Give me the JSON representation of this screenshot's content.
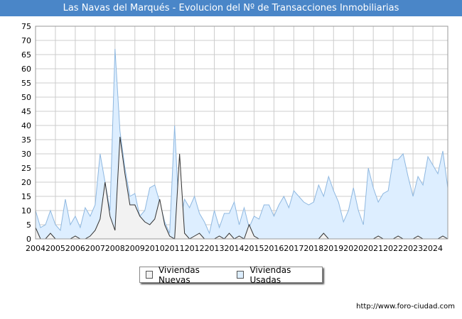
{
  "title": "Las Navas del Marqués - Evolucion del Nº de Transacciones Inmobiliarias",
  "footer": "http://www.foro-ciudad.com",
  "colors": {
    "title_bg": "#4a86c8",
    "nuevas_fill": "#f2f2f2",
    "nuevas_line": "#333333",
    "usadas_fill": "#ddeeff",
    "usadas_line": "#8fb8e0",
    "grid": "#cccccc"
  },
  "chart_data": {
    "type": "area",
    "title": "Las Navas del Marqués - Evolucion del Nº de Transacciones Inmobiliarias",
    "xlabel": "",
    "ylabel": "",
    "x_ticks": [
      "2004",
      "2005",
      "2006",
      "2007",
      "2008",
      "2009",
      "2010",
      "2011",
      "2012",
      "2013",
      "2014",
      "2015",
      "2016",
      "2017",
      "2018",
      "2019",
      "2020",
      "2021",
      "2022",
      "2023",
      "2024"
    ],
    "y_ticks": [
      0,
      5,
      10,
      15,
      20,
      25,
      30,
      35,
      40,
      45,
      50,
      55,
      60,
      65,
      70,
      75
    ],
    "xlim": [
      2004,
      2024.75
    ],
    "ylim": [
      0,
      75
    ],
    "grid": true,
    "legend_position": "bottom-center",
    "x": [
      2004,
      2004.25,
      2004.5,
      2004.75,
      2005,
      2005.25,
      2005.5,
      2005.75,
      2006,
      2006.25,
      2006.5,
      2006.75,
      2007,
      2007.25,
      2007.5,
      2007.75,
      2008,
      2008.25,
      2008.5,
      2008.75,
      2009,
      2009.25,
      2009.5,
      2009.75,
      2010,
      2010.25,
      2010.5,
      2010.75,
      2011,
      2011.25,
      2011.5,
      2011.75,
      2012,
      2012.25,
      2012.5,
      2012.75,
      2013,
      2013.25,
      2013.5,
      2013.75,
      2014,
      2014.25,
      2014.5,
      2014.75,
      2015,
      2015.25,
      2015.5,
      2015.75,
      2016,
      2016.25,
      2016.5,
      2016.75,
      2017,
      2017.25,
      2017.5,
      2017.75,
      2018,
      2018.25,
      2018.5,
      2018.75,
      2019,
      2019.25,
      2019.5,
      2019.75,
      2020,
      2020.25,
      2020.5,
      2020.75,
      2021,
      2021.25,
      2021.5,
      2021.75,
      2022,
      2022.25,
      2022.5,
      2022.75,
      2023,
      2023.25,
      2023.5,
      2023.75,
      2024,
      2024.25,
      2024.5,
      2024.75
    ],
    "series": [
      {
        "name": "Viviendas Nuevas",
        "values": [
          4,
          0,
          0,
          2,
          0,
          0,
          0,
          0,
          1,
          0,
          0,
          1,
          3,
          7,
          20,
          8,
          3,
          36,
          23,
          12,
          12,
          8,
          6,
          5,
          7,
          14,
          5,
          1,
          0,
          30,
          2,
          0,
          1,
          2,
          0,
          0,
          0,
          1,
          0,
          2,
          0,
          1,
          0,
          5,
          1,
          0,
          0,
          0,
          0,
          0,
          0,
          0,
          0,
          0,
          0,
          0,
          0,
          0,
          2,
          0,
          0,
          0,
          0,
          0,
          0,
          0,
          0,
          0,
          0,
          1,
          0,
          0,
          0,
          1,
          0,
          0,
          0,
          1,
          0,
          0,
          0,
          0,
          1,
          0
        ]
      },
      {
        "name": "Viviendas Usadas",
        "values": [
          10,
          4,
          5,
          10,
          5,
          3,
          14,
          5,
          8,
          4,
          11,
          8,
          12,
          30,
          20,
          10,
          67,
          38,
          25,
          15,
          16,
          8,
          10,
          18,
          19,
          13,
          6,
          2,
          40,
          5,
          14,
          11,
          15,
          9,
          6,
          2,
          10,
          4,
          9,
          9,
          13,
          5,
          11,
          4,
          8,
          7,
          12,
          12,
          8,
          12,
          15,
          11,
          17,
          15,
          13,
          12,
          13,
          19,
          15,
          22,
          17,
          13,
          6,
          10,
          18,
          10,
          5,
          25,
          18,
          13,
          16,
          17,
          28,
          28,
          30,
          22,
          15,
          22,
          19,
          29,
          26,
          23,
          31,
          18
        ]
      }
    ]
  }
}
